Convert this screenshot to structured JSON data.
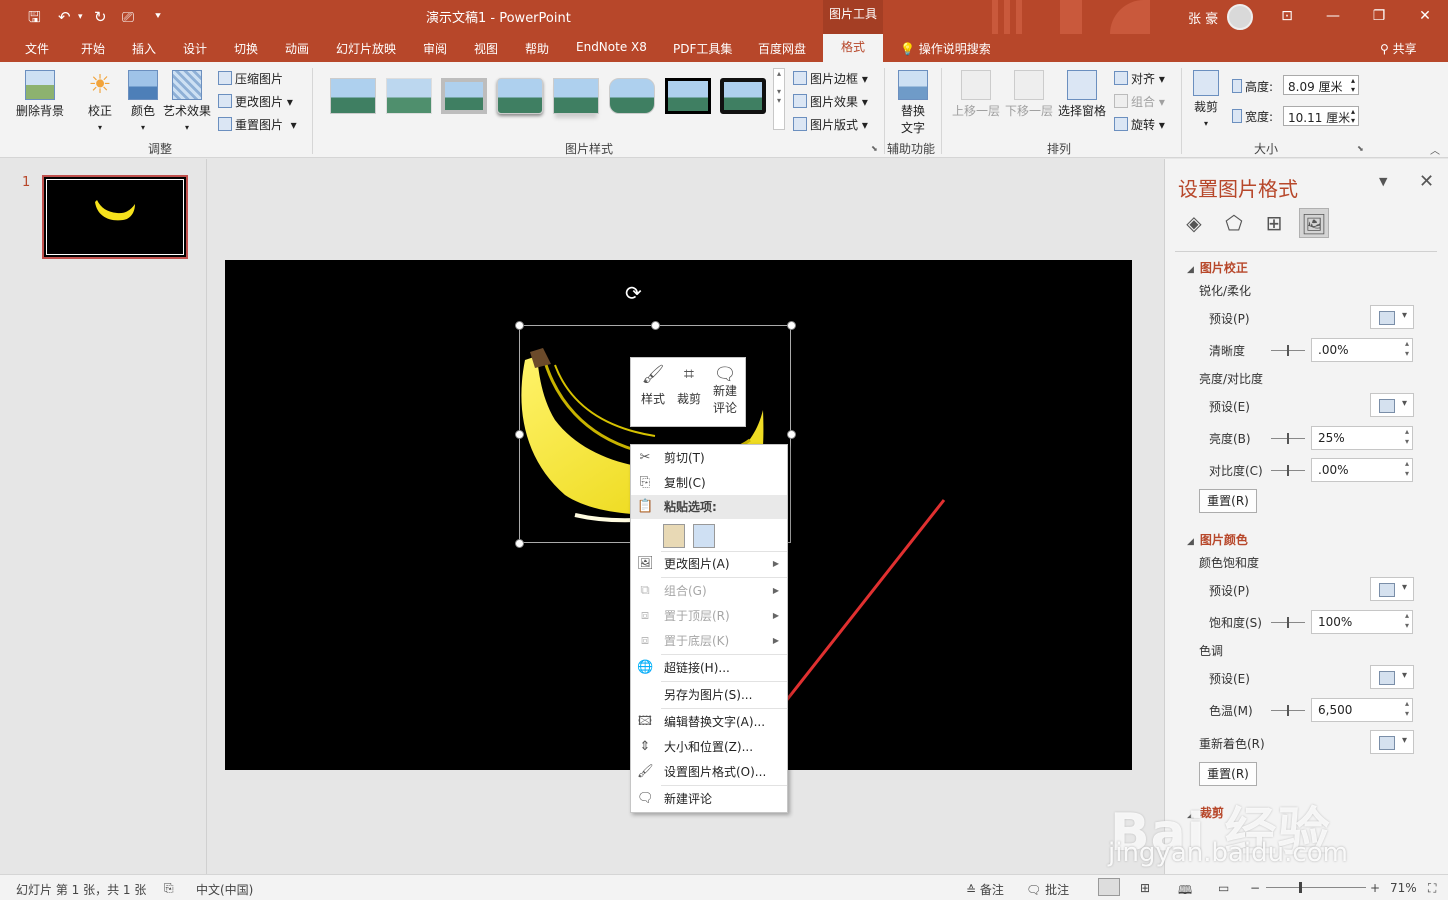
{
  "titlebar": {
    "doc_title": "演示文稿1 - PowerPoint",
    "context_group": "图片工具",
    "user_name": "张 豪"
  },
  "tabs": [
    "文件",
    "开始",
    "插入",
    "设计",
    "切换",
    "动画",
    "幻灯片放映",
    "审阅",
    "视图",
    "帮助",
    "EndNote X8",
    "PDF工具集",
    "百度网盘"
  ],
  "active_tab": "格式",
  "tell_me": "操作说明搜索",
  "share": "共享",
  "ribbon": {
    "adjust": {
      "remove_bg": "删除背景",
      "corrections": "校正",
      "color": "颜色",
      "artistic": "艺术效果",
      "compress": "压缩图片",
      "change": "更改图片",
      "reset": "重置图片",
      "label": "调整"
    },
    "styles": {
      "border": "图片边框",
      "effects": "图片效果",
      "layout": "图片版式",
      "label": "图片样式"
    },
    "accessibility": {
      "alt_text_1": "替换",
      "alt_text_2": "文字",
      "label": "辅助功能"
    },
    "arrange": {
      "bring_forward": "上移一层",
      "send_backward": "下移一层",
      "selection_pane": "选择窗格",
      "align": "对齐",
      "group": "组合",
      "rotate": "旋转",
      "label": "排列"
    },
    "size": {
      "crop": "裁剪",
      "height_label": "高度:",
      "height_value": "8.09 厘米",
      "width_label": "宽度:",
      "width_value": "10.11 厘米",
      "label": "大小"
    }
  },
  "slides_pane": {
    "slide_number": "1"
  },
  "mini_toolbar": {
    "style": "样式",
    "crop": "裁剪",
    "new_comment_1": "新建",
    "new_comment_2": "评论"
  },
  "context_menu": {
    "cut": "剪切(T)",
    "copy": "复制(C)",
    "paste_options": "粘贴选项:",
    "change_picture": "更改图片(A)",
    "group": "组合(G)",
    "bring_to_front": "置于顶层(R)",
    "send_to_back": "置于底层(K)",
    "hyperlink": "超链接(H)...",
    "save_as_picture": "另存为图片(S)...",
    "edit_alt_text": "编辑替换文字(A)...",
    "size_position": "大小和位置(Z)...",
    "format_picture": "设置图片格式(O)...",
    "new_comment": "新建评论"
  },
  "format_pane": {
    "title": "设置图片格式",
    "corrections_section": "图片校正",
    "sharpen_soften": "锐化/柔化",
    "presets": "预设(P)",
    "sharpness": "清晰度",
    "sharpness_value": ".00%",
    "brightness_contrast": "亮度/对比度",
    "presets_e": "预设(E)",
    "brightness": "亮度(B)",
    "brightness_value": "25%",
    "contrast": "对比度(C)",
    "contrast_value": ".00%",
    "reset": "重置(R)",
    "color_section": "图片颜色",
    "saturation_group": "颜色饱和度",
    "presets_p2": "预设(P)",
    "saturation": "饱和度(S)",
    "saturation_value": "100%",
    "tone": "色调",
    "presets_e2": "预设(E)",
    "temperature": "色温(M)",
    "temperature_value": "6,500",
    "recolor": "重新着色(R)",
    "reset2": "重置(R)",
    "crop_section": "裁剪"
  },
  "statusbar": {
    "slide_info": "幻灯片 第 1 张，共 1 张",
    "language": "中文(中国)",
    "notes": "备注",
    "comments": "批注",
    "zoom": "71%"
  },
  "watermark": {
    "brand": "Bai 经验",
    "url": "jingyan.baidu.com"
  },
  "colors": {
    "accent": "#b7472a",
    "arrow": "#e03030"
  }
}
